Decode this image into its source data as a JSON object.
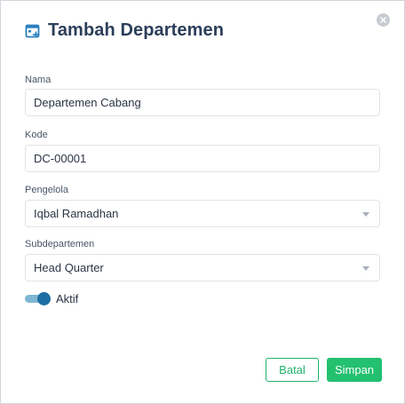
{
  "dialog": {
    "title": "Tambah Departemen",
    "close_icon": "close-icon",
    "title_icon": "calendar-add-icon"
  },
  "form": {
    "nama": {
      "label": "Nama",
      "value": "Departemen Cabang"
    },
    "kode": {
      "label": "Kode",
      "value": "DC-00001"
    },
    "pengelola": {
      "label": "Pengelola",
      "value": "Iqbal Ramadhan"
    },
    "subdepartemen": {
      "label": "Subdepartemen",
      "value": "Head Quarter"
    },
    "aktif": {
      "label": "Aktif",
      "on": true
    }
  },
  "actions": {
    "cancel_label": "Batal",
    "save_label": "Simpan"
  },
  "colors": {
    "primary": "#22c06f",
    "title": "#2c3e5a",
    "toggle": "#1e6fa3"
  }
}
